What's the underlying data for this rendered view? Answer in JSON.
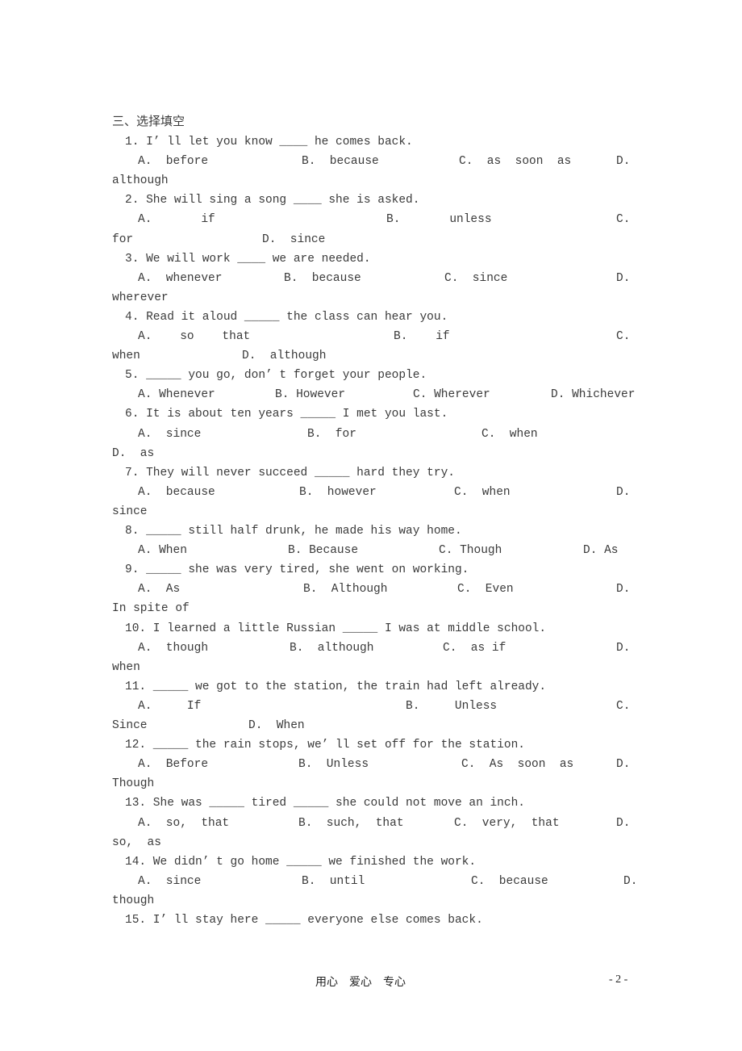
{
  "section_title": "三、选择填空",
  "questions": [
    {
      "text": "1. I’ ll let you know ____ he comes back.",
      "options": [
        "A.  before",
        "B.  because",
        "C.  as  soon  as",
        "D."
      ],
      "wrap": "although"
    },
    {
      "text": "2. She will sing a song ____ she is asked.",
      "options": [
        "A.       if",
        "B.       unless",
        "C."
      ],
      "wrap": "for",
      "wrap_option": "D.  since"
    },
    {
      "text": "3. We will work ____ we are needed.",
      "options": [
        "A.  whenever",
        "B.  because",
        "C.  since",
        "D."
      ],
      "wrap": "wherever"
    },
    {
      "text": "4. Read it aloud _____ the class can hear you.",
      "options": [
        "A.    so    that",
        "B.    if",
        "C."
      ],
      "wrap": "when",
      "wrap_option": "D.  although"
    },
    {
      "text": "5. _____ you go, don’ t forget your people.",
      "options": [
        "A. Whenever",
        "B. However",
        "C. Wherever",
        "D. Whichever"
      ]
    },
    {
      "text": "6. It is about ten years _____ I met you last.",
      "options": [
        "A.  since",
        "B.  for",
        "C.  when"
      ],
      "wrap": "D.  as"
    },
    {
      "text": "7. They will never succeed _____ hard they try.",
      "options": [
        "A.  because",
        "B.  however",
        "C.  when",
        "D."
      ],
      "wrap": "since"
    },
    {
      "text": "8. _____ still half drunk, he made his way home.",
      "options": [
        "A. When",
        "B. Because",
        "C. Though",
        "D. As"
      ]
    },
    {
      "text": "9. _____ she was very tired, she went on working.",
      "options": [
        "A.  As",
        "B.  Although",
        "C.  Even",
        "D."
      ],
      "wrap": "In spite of"
    },
    {
      "text": "10. I learned a little Russian _____ I was at middle school.",
      "options": [
        "A.  though",
        "B.  although",
        "C.  as if",
        "D."
      ],
      "wrap": "when"
    },
    {
      "text": "11. _____ we got to the station, the train had left already.",
      "options": [
        "A.     If",
        "B.     Unless",
        "C."
      ],
      "wrap": "Since",
      "wrap_option": "D.  When"
    },
    {
      "text": "12. _____ the rain stops, we’ ll set off for the station.",
      "options": [
        "A.  Before",
        "B.  Unless",
        "C.  As  soon  as",
        "D."
      ],
      "wrap": "Though"
    },
    {
      "text": "13. She was _____ tired _____ she could not move an inch.",
      "options": [
        "A.  so,  that",
        "B.  such,  that",
        "C.  very,  that",
        "D."
      ],
      "wrap": "so,  as"
    },
    {
      "text": "14. We didn’ t go home _____ we finished the work.",
      "options": [
        "A.  since",
        "B.  until",
        "C.  because",
        "D."
      ],
      "wrap": "though"
    },
    {
      "text": "15. I’ ll stay here _____ everyone else comes back."
    }
  ],
  "footer": {
    "motto": "用心　爱心　专心",
    "page_number": "- 2 -"
  }
}
